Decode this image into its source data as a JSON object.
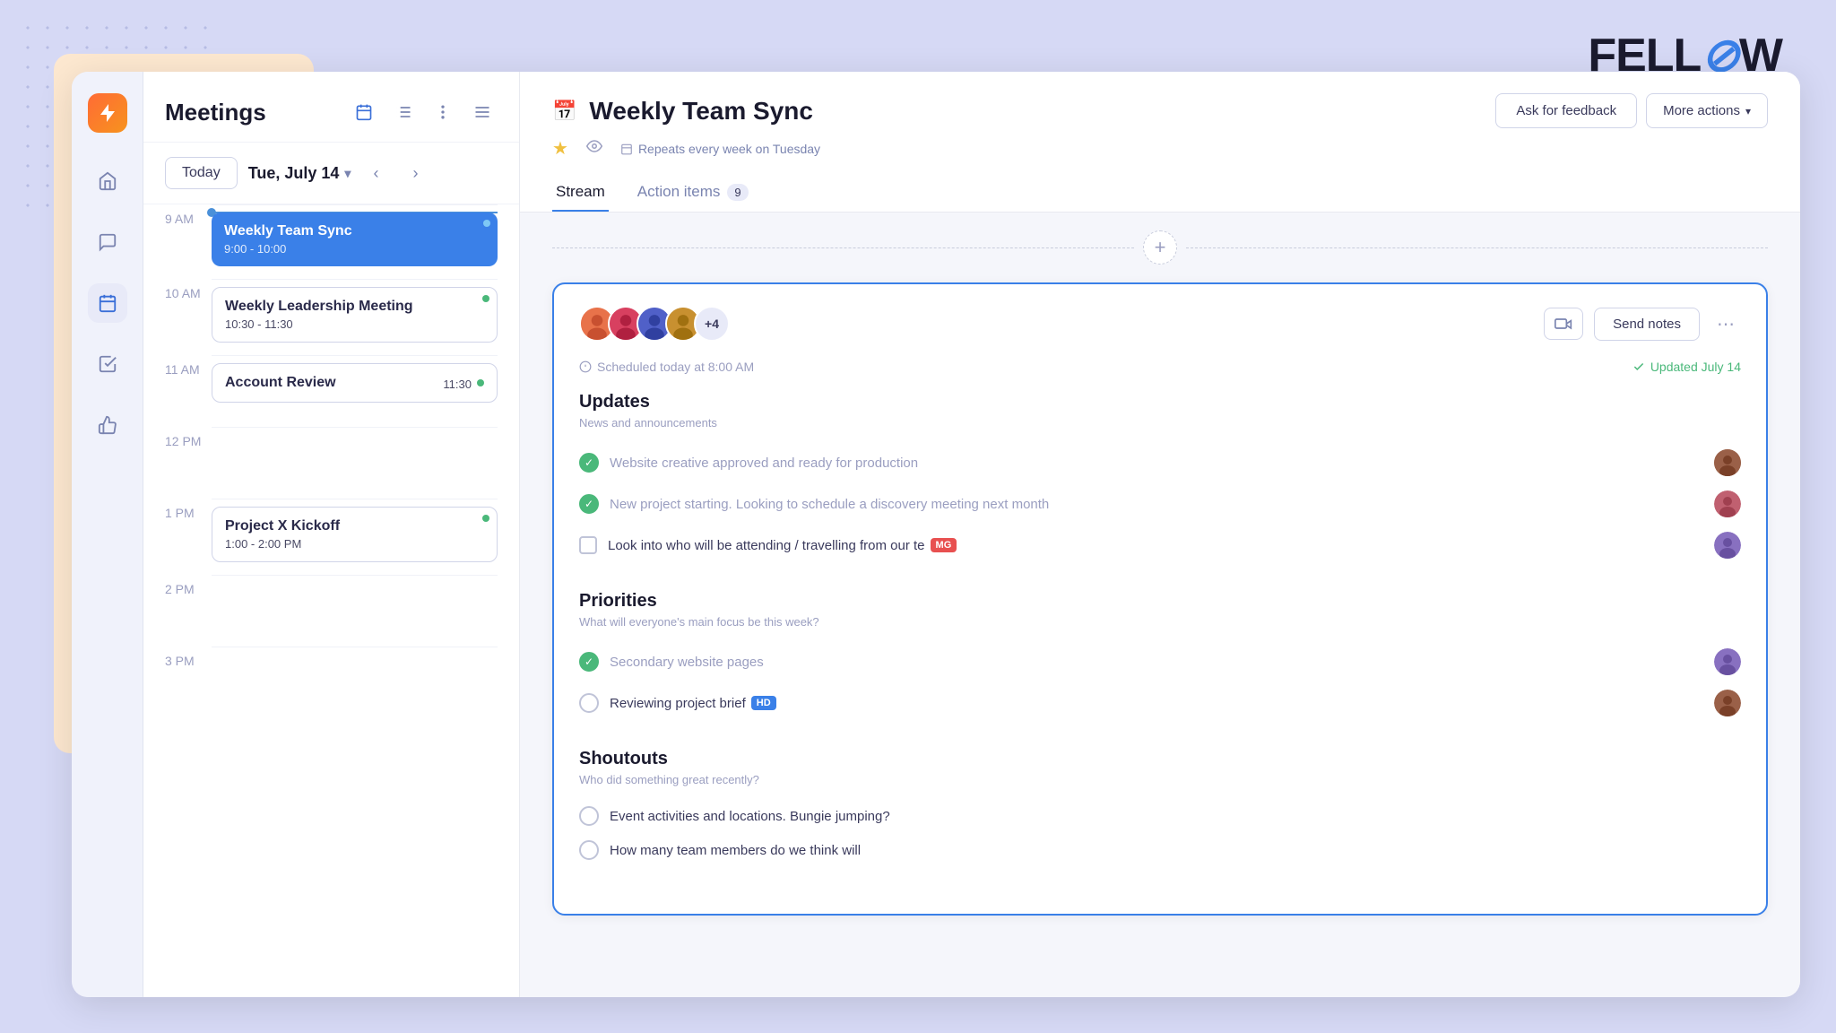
{
  "logo": {
    "text": "FELL",
    "slash": "⌀",
    "suffix": "W"
  },
  "sidebar": {
    "icons": [
      {
        "name": "app-logo",
        "symbol": "⚡"
      },
      {
        "name": "home",
        "symbol": "⌂"
      },
      {
        "name": "chat",
        "symbol": "≡"
      },
      {
        "name": "calendar",
        "symbol": "📅"
      },
      {
        "name": "tasks",
        "symbol": "✓"
      },
      {
        "name": "thumbs-up",
        "symbol": "👍"
      }
    ]
  },
  "meetings": {
    "title": "Meetings",
    "today_label": "Today",
    "date": "Tue, July 14",
    "events": [
      {
        "id": "weekly-team-sync",
        "title": "Weekly Team Sync",
        "time": "9:00 - 10:00",
        "type": "blue"
      },
      {
        "id": "weekly-leadership",
        "title": "Weekly Leadership Meeting",
        "time": "10:30 - 11:30",
        "type": "outline"
      },
      {
        "id": "account-review",
        "title": "Account Review",
        "time": "11:30",
        "type": "outline"
      },
      {
        "id": "project-x",
        "title": "Project X Kickoff",
        "time": "1:00 - 2:00 PM",
        "type": "outline"
      }
    ],
    "time_slots": [
      "9 AM",
      "10 AM",
      "11 AM",
      "12 PM",
      "1 PM",
      "2 PM",
      "3 PM"
    ]
  },
  "detail": {
    "title": "Weekly Team Sync",
    "repeat_text": "Repeats every week on Tuesday",
    "ask_feedback_label": "Ask for feedback",
    "more_actions_label": "More actions",
    "tabs": [
      {
        "id": "stream",
        "label": "Stream",
        "active": true
      },
      {
        "id": "action-items",
        "label": "Action items",
        "badge": "9"
      }
    ],
    "scheduled_text": "Scheduled today at 8:00 AM",
    "updated_text": "Updated July 14",
    "send_notes_label": "Send notes",
    "attendee_count": "+4",
    "sections": [
      {
        "id": "updates",
        "title": "Updates",
        "subtitle": "News and announcements",
        "items": [
          {
            "text": "Website creative approved and ready for production",
            "status": "checked",
            "has_avatar": true
          },
          {
            "text": "New project starting. Looking to schedule a discovery meeting next month",
            "status": "checked",
            "has_avatar": true
          },
          {
            "text": "Look into who will be attending / travelling from our te",
            "status": "unchecked-square",
            "tag": "MG",
            "tag_class": "tag-mg",
            "has_avatar": true
          }
        ]
      },
      {
        "id": "priorities",
        "title": "Priorities",
        "subtitle": "What will everyone's main focus be this week?",
        "items": [
          {
            "text": "Secondary website pages",
            "status": "checked",
            "has_avatar": true
          },
          {
            "text": "Reviewing project brief",
            "status": "unchecked",
            "tag": "HD",
            "tag_class": "tag-hd",
            "has_avatar": true
          }
        ]
      },
      {
        "id": "shoutouts",
        "title": "Shoutouts",
        "subtitle": "Who did something great recently?",
        "items": [
          {
            "text": "Event activities and locations. Bungie jumping?",
            "status": "unchecked",
            "has_avatar": false
          },
          {
            "text": "How many team members do we think will",
            "status": "unchecked",
            "has_avatar": false
          }
        ]
      }
    ]
  }
}
